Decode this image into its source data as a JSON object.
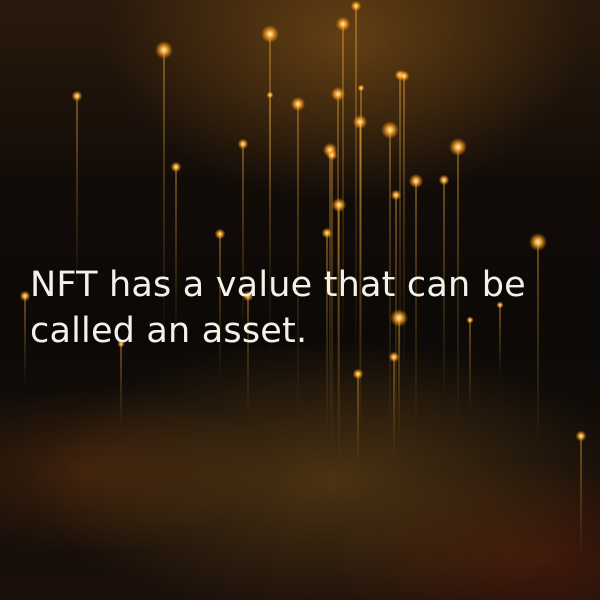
{
  "caption": {
    "text": "NFT has a value that can be called an asset."
  },
  "colors": {
    "background": "#0b0806",
    "glow": "#ffb43c",
    "text": "#f4f1ea"
  }
}
